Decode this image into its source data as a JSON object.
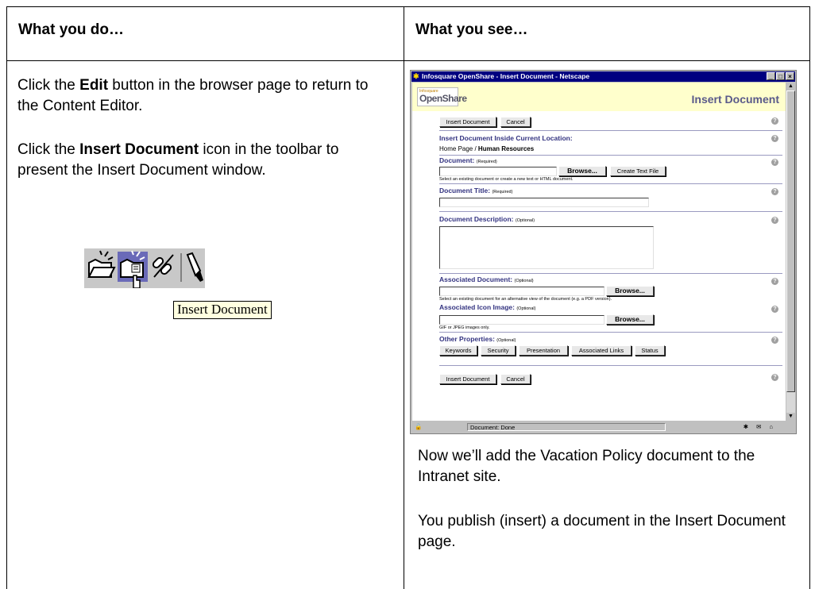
{
  "columns": {
    "left_header": "What you do…",
    "right_header": "What you see…"
  },
  "left": {
    "para1": {
      "before": "Click the ",
      "bold": "Edit",
      "after": " button in the browser page to return to the Content Editor."
    },
    "para2": {
      "before": "Click the ",
      "bold": "Insert Document",
      "after": " icon in the toolbar to present the Insert Document window."
    },
    "tooltip": "Insert Document",
    "toolbar_icons": [
      "open-folder-icon",
      "insert-document-icon",
      "link-icon",
      "tools-icon"
    ]
  },
  "window": {
    "title": "Infosquare OpenShare - Insert Document - Netscape",
    "logo_small": "Infosquare",
    "logo": "OpenShare",
    "page_title": "Insert Document",
    "insert_button": "Insert Document",
    "cancel_button": "Cancel",
    "location_label": "Insert Document Inside Current Location:",
    "breadcrumb_home": "Home Page",
    "breadcrumb_sep": " / ",
    "breadcrumb_current": "Human Resources",
    "document_label": "Document:",
    "required": "(Required)",
    "optional": "(Optional)",
    "browse_button": "Browse...",
    "create_text_button": "Create Text File",
    "document_hint": "Select an existing document or create a new text or HTML document.",
    "title_label": "Document Title:",
    "description_label": "Document Description:",
    "assoc_doc_label": "Associated Document:",
    "assoc_doc_hint": "Select an existing document for an alternative view of the document (e.g. a PDF version).",
    "assoc_icon_label": "Associated Icon Image:",
    "assoc_icon_hint": "GIF or JPEG images only.",
    "other_props_label": "Other Properties:",
    "property_buttons": [
      "Keywords",
      "Security",
      "Presentation",
      "Associated Links",
      "Status"
    ],
    "status_text": "Document: Done"
  },
  "right": {
    "para1": "Now we’ll add the Vacation Policy document to the Intranet site.",
    "para2": "You publish (insert) a document in the Insert Document page."
  }
}
